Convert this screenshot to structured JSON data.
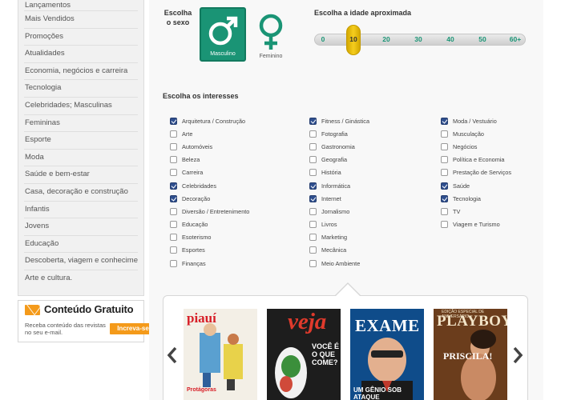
{
  "sidebar": {
    "items": [
      {
        "label": "Lançamentos"
      },
      {
        "label": "Mais Vendidos"
      },
      {
        "label": "Promoções"
      },
      {
        "label": "Atualidades"
      },
      {
        "label": "Economia, negócios e carreira"
      },
      {
        "label": "Tecnologia"
      },
      {
        "label": "Celebridades; Masculinas"
      },
      {
        "label": "Femininas"
      },
      {
        "label": "Esporte"
      },
      {
        "label": "Moda"
      },
      {
        "label": "Saúde e bem-estar"
      },
      {
        "label": "Casa, decoração e construção"
      },
      {
        "label": "Infantis"
      },
      {
        "label": "Jovens"
      },
      {
        "label": "Educação"
      },
      {
        "label": "Descoberta, viagem e conhecimento"
      },
      {
        "label": "Arte e cultura."
      }
    ]
  },
  "promo": {
    "title": "Conteúdo Gratuito",
    "text": "Receba conteúdo das revistas no seu e-mail.",
    "button_label": "Increva-se",
    "icon": "envelope-icon"
  },
  "sexo": {
    "label": "Escolha o sexo",
    "options": [
      {
        "label": "Masculino",
        "icon": "male-symbol-icon",
        "selected": true
      },
      {
        "label": "Feminino",
        "icon": "female-symbol-icon",
        "selected": false
      }
    ]
  },
  "idade": {
    "label": "Escolha a idade aproximada",
    "ticks": [
      "0",
      "10",
      "20",
      "30",
      "40",
      "50",
      "60+"
    ],
    "selected": "10"
  },
  "interesses": {
    "label": "Escolha os interesses",
    "columns": [
      [
        {
          "label": "Arquitetura / Construção",
          "checked": true
        },
        {
          "label": "Arte",
          "checked": false
        },
        {
          "label": "Automóveis",
          "checked": false
        },
        {
          "label": "Beleza",
          "checked": false
        },
        {
          "label": "Carreira",
          "checked": false
        },
        {
          "label": "Celebridades",
          "checked": true
        },
        {
          "label": "Decoração",
          "checked": true
        },
        {
          "label": "Diversão / Entretenimento",
          "checked": false
        },
        {
          "label": "Educação",
          "checked": false
        },
        {
          "label": "Esoterismo",
          "checked": false
        },
        {
          "label": "Esportes",
          "checked": false
        },
        {
          "label": "Finanças",
          "checked": false
        }
      ],
      [
        {
          "label": "Fitness / Ginástica",
          "checked": true
        },
        {
          "label": "Fotografia",
          "checked": false
        },
        {
          "label": "Gastronomia",
          "checked": false
        },
        {
          "label": "Geografia",
          "checked": false
        },
        {
          "label": "História",
          "checked": false
        },
        {
          "label": "Informática",
          "checked": true
        },
        {
          "label": "Internet",
          "checked": true
        },
        {
          "label": "Jornalismo",
          "checked": false
        },
        {
          "label": "Livros",
          "checked": false
        },
        {
          "label": "Marketing",
          "checked": false
        },
        {
          "label": "Mecânica",
          "checked": false
        },
        {
          "label": "Meio Ambiente",
          "checked": false
        }
      ],
      [
        {
          "label": "Moda / Vestuário",
          "checked": true
        },
        {
          "label": "Musculação",
          "checked": false
        },
        {
          "label": "Negócios",
          "checked": false
        },
        {
          "label": "Política e Economia",
          "checked": false
        },
        {
          "label": "Prestação de Serviços",
          "checked": false
        },
        {
          "label": "Saúde",
          "checked": true
        },
        {
          "label": "Tecnologia",
          "checked": true
        },
        {
          "label": "TV",
          "checked": false
        },
        {
          "label": "Viagem e Turismo",
          "checked": false
        }
      ]
    ]
  },
  "carousel": {
    "prev_icon": "chevron-left-icon",
    "next_icon": "chevron-right-icon",
    "magazines": [
      {
        "title": "piauí",
        "headline": "Protágoras"
      },
      {
        "title": "veja",
        "headline": "VOCÊ É O QUE COME?"
      },
      {
        "title": "EXAME",
        "headline": "UM GÊNIO SOB ATAQUE"
      },
      {
        "title": "PLAYBOY",
        "headline": "PRISCILA!",
        "kicker": "EDIÇÃO ESPECIAL DE ANIVERSÁRIO"
      }
    ]
  },
  "colors": {
    "accent_green": "#1a9475",
    "orange": "#f49a1a",
    "checkbox_blue": "#2f4f8e",
    "slider_thumb": "#f5cd1e"
  }
}
